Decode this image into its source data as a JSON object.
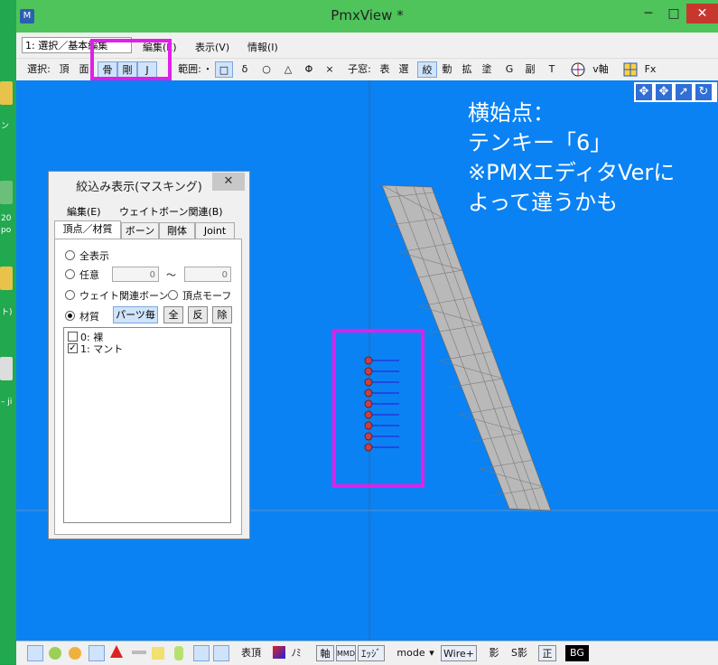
{
  "desktop": {
    "labels": [
      "ン",
      "20",
      "po",
      "ト)",
      "– ji"
    ]
  },
  "window": {
    "title": "PmxView *",
    "minimize": "─",
    "maximize": "□",
    "close": "✕",
    "app_icon": "M"
  },
  "menubar": {
    "mode_combo": "1: 選択／基本編集",
    "items": [
      "編集(E)",
      "表示(V)",
      "情報(I)"
    ]
  },
  "toolbar": {
    "select_label": "選択:",
    "select_items": [
      "頂",
      "面",
      "骨",
      "剛",
      "J"
    ],
    "range_label": "範囲:",
    "range_items": [
      "・",
      "□",
      "δ",
      "○",
      "△",
      "Φ",
      "×"
    ],
    "subwin_label": "子窓:",
    "subwin_items": [
      "表",
      "選",
      "絞",
      "動",
      "拡",
      "塗",
      "G",
      "副",
      "T"
    ],
    "axis_label": "v軸",
    "fx_label": "Fx"
  },
  "viewport": {
    "annotation": [
      "横始点：",
      "テンキー「6」",
      "※PMXエディタVerに",
      "よって違うかも"
    ]
  },
  "dialog": {
    "title": "絞込み表示(マスキング)",
    "close": "✕",
    "menu": [
      "編集(E)",
      "ウェイトボーン関連(B)"
    ],
    "tabs": [
      "頂点／材質",
      "ボーン",
      "剛体",
      "Joint"
    ],
    "options": {
      "all": "全表示",
      "any": "任意",
      "range_from": "0",
      "range_sep": "〜",
      "range_to": "0",
      "weight_bone": "ウェイト関連ボーン",
      "vertex_morph": "頂点モーフ",
      "material": "材質",
      "per_part_button": "パーツ毎",
      "all_button": "全",
      "invert_button": "反",
      "remove_button": "除"
    },
    "materials": [
      {
        "label": "0: 裸",
        "checked": false
      },
      {
        "label": "1: マント",
        "checked": true
      }
    ]
  },
  "statusbar": {
    "surface_vertex": "表頂",
    "nomi": "ﾉﾐ",
    "axis": "軸",
    "mmd": "MMD",
    "edge": "ｴｯｼﾞ",
    "mode": "mode",
    "mode_arrow": "▾",
    "wire": "Wire+",
    "shadow": "影",
    "sshadow": "S影",
    "correct": "正",
    "bg": "BG"
  },
  "colors": {
    "viewport_bg": "#0a82f3",
    "highlight": "#e020e8",
    "titlebar": "#4ec45b"
  }
}
